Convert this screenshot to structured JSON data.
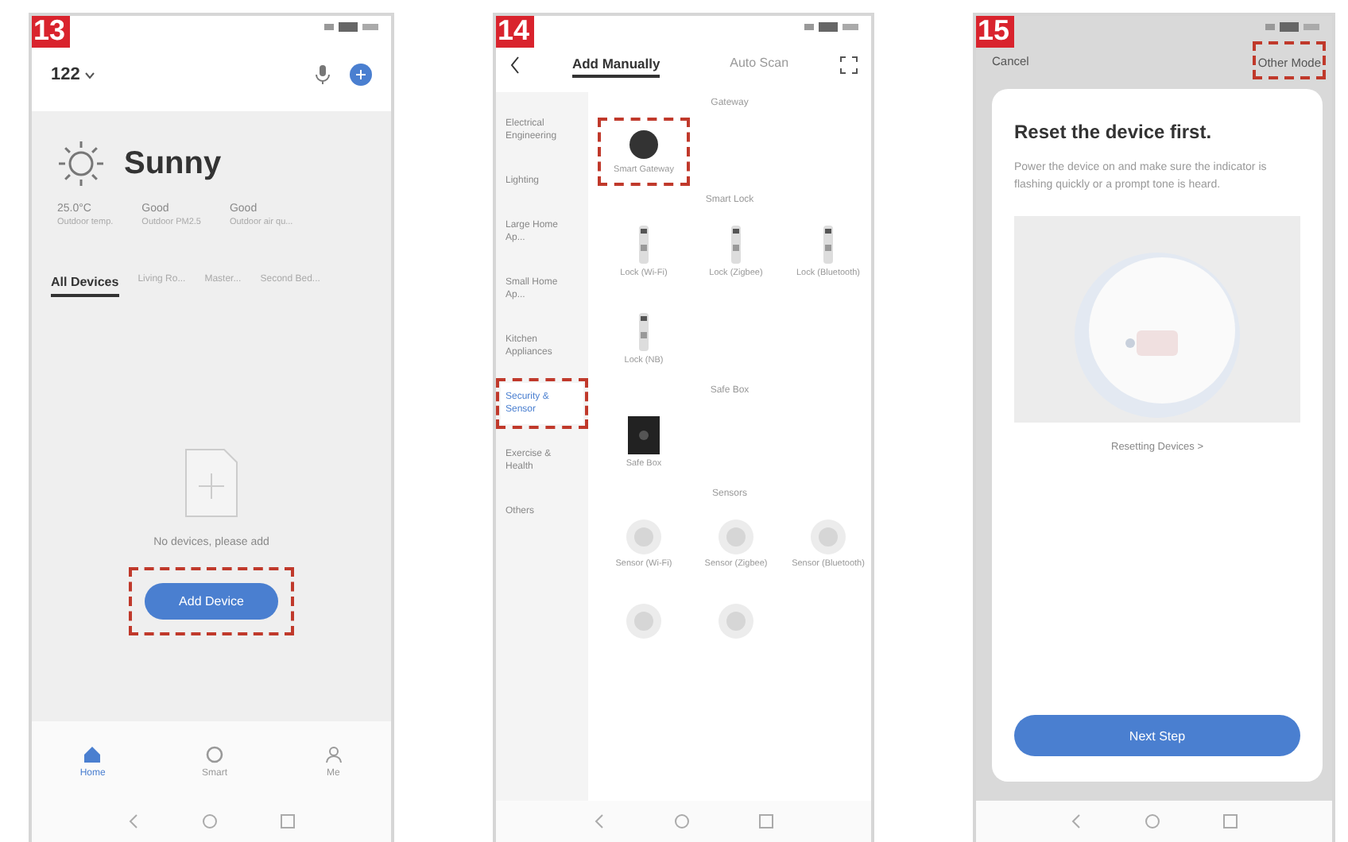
{
  "screens": [
    {
      "kind": "home",
      "step": "13",
      "home_name": "122",
      "weather": {
        "condition": "Sunny",
        "stats": [
          {
            "value": "25.0°C",
            "label": "Outdoor temp."
          },
          {
            "value": "Good",
            "label": "Outdoor PM2.5"
          },
          {
            "value": "Good",
            "label": "Outdoor air qu..."
          }
        ]
      },
      "rooms": [
        {
          "label": "All Devices",
          "selected": true
        },
        {
          "label": "Living Ro...",
          "selected": false
        },
        {
          "label": "Master...",
          "selected": false
        },
        {
          "label": "Second Bed...",
          "selected": false
        }
      ],
      "empty_text": "No devices, please add",
      "button": {
        "label": "Add Device",
        "highlighted": true
      },
      "nav": [
        {
          "label": "Home",
          "selected": true
        },
        {
          "label": "Smart",
          "selected": false
        },
        {
          "label": "Me",
          "selected": false
        }
      ]
    },
    {
      "kind": "add",
      "step": "14",
      "tabs": [
        {
          "label": "Add Manually",
          "selected": true
        },
        {
          "label": "Auto Scan",
          "selected": false
        }
      ],
      "categories": [
        {
          "label": "Electrical Engineering",
          "selected": false,
          "highlighted": false
        },
        {
          "label": "Lighting",
          "selected": false,
          "highlighted": false
        },
        {
          "label": "Large Home Ap...",
          "selected": false,
          "highlighted": false
        },
        {
          "label": "Small Home Ap...",
          "selected": false,
          "highlighted": false
        },
        {
          "label": "Kitchen Appliances",
          "selected": false,
          "highlighted": false
        },
        {
          "label": "Security & Sensor",
          "selected": true,
          "highlighted": true
        },
        {
          "label": "Exercise & Health",
          "selected": false,
          "highlighted": false
        },
        {
          "label": "Others",
          "selected": false,
          "highlighted": false
        }
      ],
      "sections": [
        {
          "title": "Gateway",
          "items": [
            {
              "kind": "hub",
              "label": "Smart Gateway",
              "highlighted": true
            }
          ]
        },
        {
          "title": "Smart Lock",
          "items": [
            {
              "kind": "lock",
              "label": "Lock (Wi-Fi)",
              "highlighted": false
            },
            {
              "kind": "lock",
              "label": "Lock (Zigbee)",
              "highlighted": false
            },
            {
              "kind": "lock",
              "label": "Lock (Bluetooth)",
              "highlighted": false
            },
            {
              "kind": "lock",
              "label": "Lock (NB)",
              "highlighted": false
            }
          ]
        },
        {
          "title": "Safe Box",
          "items": [
            {
              "kind": "box",
              "label": "Safe Box",
              "highlighted": false
            }
          ]
        },
        {
          "title": "Sensors",
          "items": [
            {
              "kind": "sensor",
              "label": "Sensor (Wi-Fi)",
              "highlighted": false
            },
            {
              "kind": "sensor",
              "label": "Sensor (Zigbee)",
              "highlighted": false
            },
            {
              "kind": "sensor",
              "label": "Sensor (Bluetooth)",
              "highlighted": false
            },
            {
              "kind": "sensor",
              "highlighted": false
            },
            {
              "kind": "sensor",
              "highlighted": false
            }
          ]
        }
      ]
    },
    {
      "kind": "reset",
      "step": "15",
      "cancel": "Cancel",
      "other_mode": {
        "label": "Other Mode",
        "highlighted": true
      },
      "title": "Reset the device first.",
      "description": "Power the device on and make sure the indicator is flashing quickly or a prompt tone is heard.",
      "link": "Resetting Devices >",
      "button": "Next Step"
    }
  ]
}
